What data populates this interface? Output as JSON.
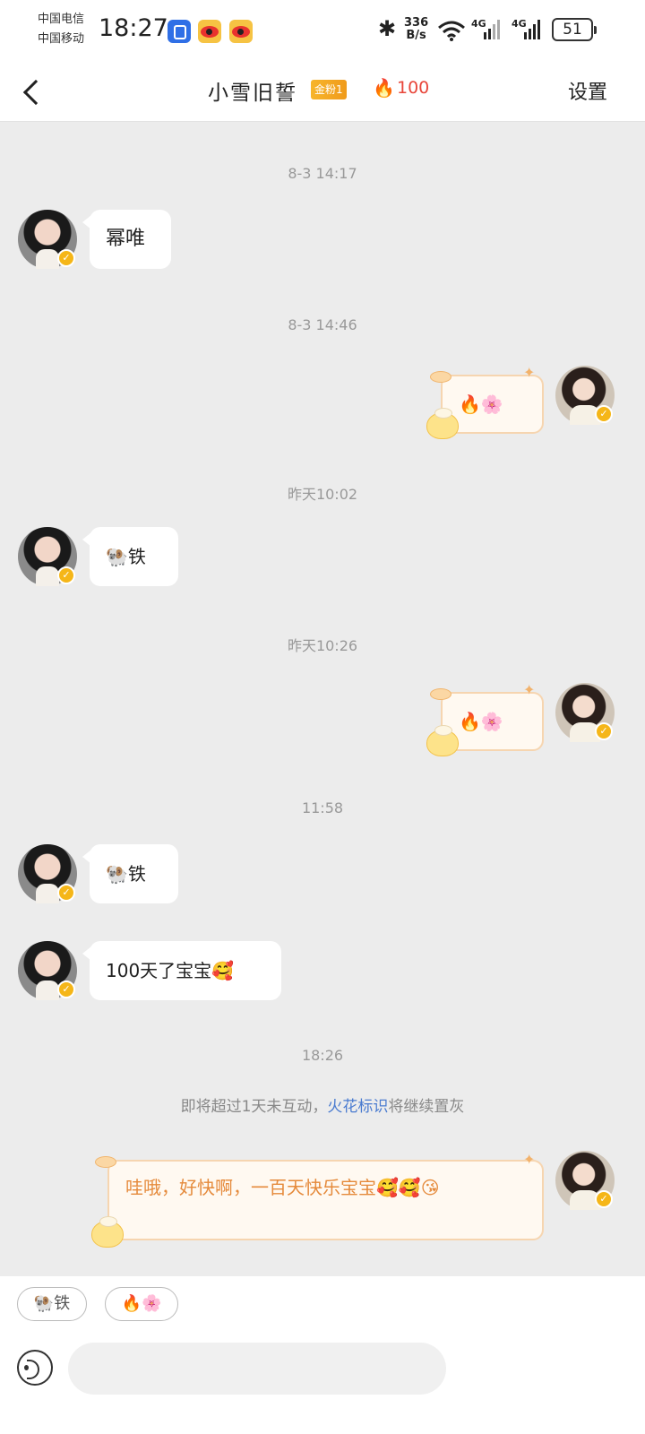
{
  "status_bar": {
    "carrier_1": "中国电信",
    "carrier_2": "中国移动",
    "time": "18:27",
    "net_speed_value": "336",
    "net_speed_unit": "B/s",
    "signal_1_label": "4G",
    "signal_2_label": "4G",
    "battery": "51",
    "bluetooth_icon": "bluetooth-icon",
    "wifi_icon": "wifi-icon"
  },
  "header": {
    "title": "小雪旧誓",
    "fan_badge": "金粉1",
    "fire_count": "100",
    "settings_label": "设置"
  },
  "messages": [
    {
      "time": "8-3 14:17",
      "from": "other",
      "text": "幂唯"
    },
    {
      "time": "8-3 14:46",
      "from": "me",
      "text": "🔥🌸"
    },
    {
      "time": "昨天10:02",
      "from": "other",
      "text": "🐏铁"
    },
    {
      "time": "昨天10:26",
      "from": "me",
      "text": "🔥🌸"
    },
    {
      "time": "11:58",
      "from": "other",
      "text": "🐏铁"
    },
    {
      "time": "",
      "from": "other",
      "text": "100天了宝宝🥰"
    },
    {
      "time": "18:26",
      "from": "me",
      "text": "哇哦，好快啊，一百天快乐宝宝🥰🥰😘"
    }
  ],
  "hint": {
    "prefix": "即将超过1天未互动，",
    "link": "火花标识",
    "suffix": "将继续置灰"
  },
  "quick_replies": [
    "🐏铁",
    "🔥🌸"
  ],
  "input": {
    "placeholder": ""
  },
  "colors": {
    "accent_fire": "#e8463a",
    "link": "#4a7bd0",
    "fancy_text": "#e58a3b",
    "badge_gold": "#f5b618"
  }
}
